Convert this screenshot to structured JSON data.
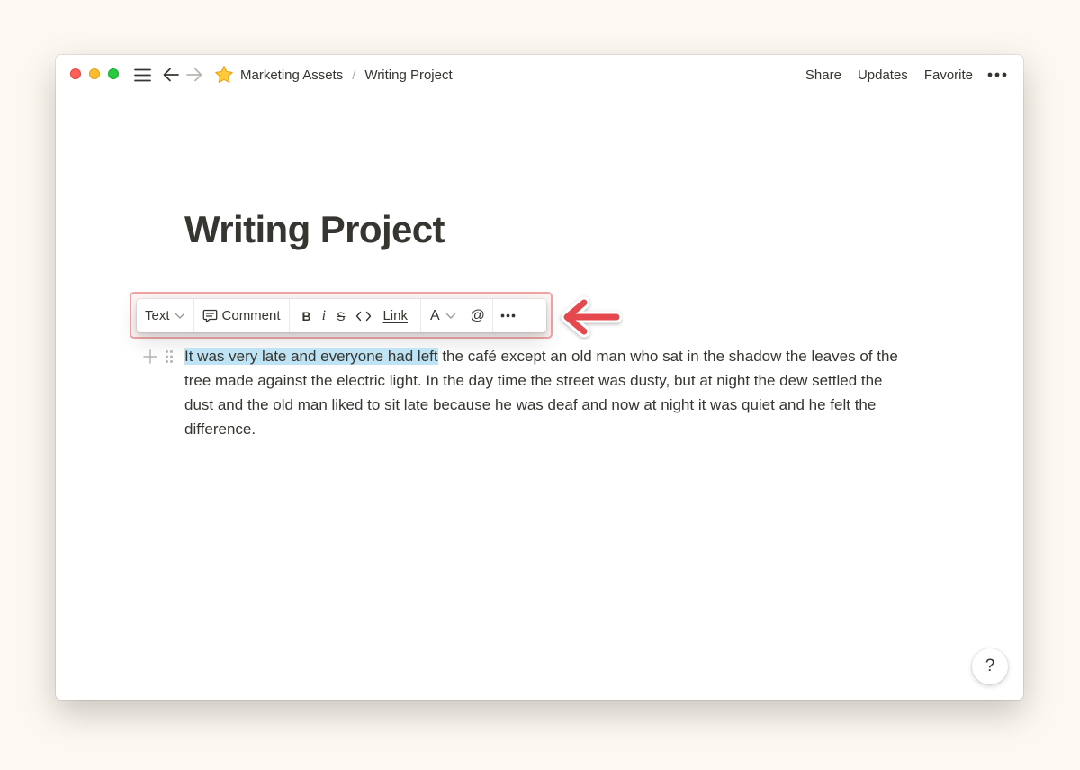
{
  "breadcrumb": {
    "icon": "star-icon",
    "items": [
      "Marketing Assets",
      "Writing Project"
    ],
    "separator": "/"
  },
  "topbar": {
    "share_label": "Share",
    "updates_label": "Updates",
    "favorite_label": "Favorite",
    "more_icon": "more-horizontal-icon"
  },
  "page": {
    "title": "Writing Project"
  },
  "toolbar": {
    "block_type_label": "Text",
    "comment_label": "Comment",
    "bold_label": "B",
    "italic_label": "i",
    "strike_label": "S",
    "link_label": "Link",
    "color_label": "A",
    "mention_label": "@"
  },
  "paragraph": {
    "selected_text": "It was very late and everyone had left",
    "rest_text": " the café except an old man who sat in the shadow the leaves of the tree made against the electric light. In the day time the street was dusty, but at night the dew settled the dust and the old man liked to sit late because he was deaf and now at night it was quiet and he felt the difference."
  },
  "help": {
    "label": "?"
  },
  "colors": {
    "selection": "#bee3f4",
    "annotation_red": "#e5484d",
    "text": "#37352f"
  }
}
